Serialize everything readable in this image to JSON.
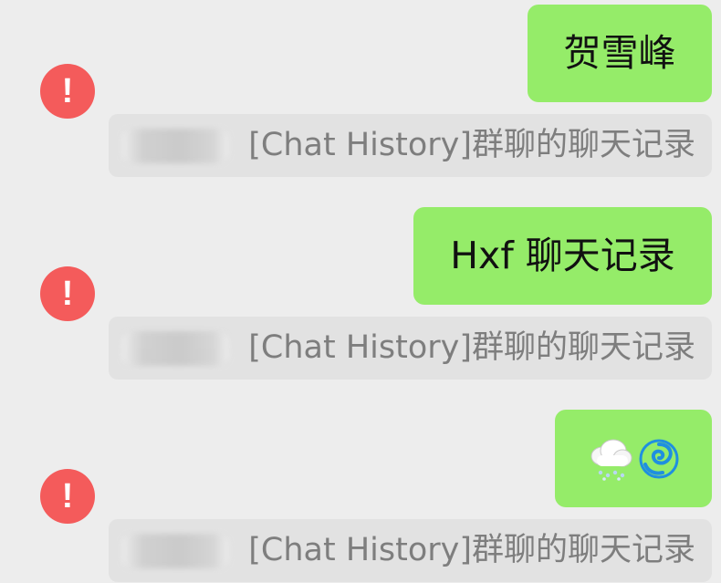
{
  "messages": [
    {
      "text": "贺雪峰",
      "quote": "[Chat History]群聊的聊天记录"
    },
    {
      "text": "Hxf 聊天记录",
      "quote": "[Chat History]群聊的聊天记录"
    },
    {
      "text": "",
      "icons": [
        "cloud-with-snow-icon",
        "cyclone-icon"
      ],
      "quote": "[Chat History]群聊的聊天记录"
    }
  ],
  "colors": {
    "background": "#ededed",
    "bubble": "#95ec69",
    "error": "#f45b5b",
    "quote_background": "#e2e2e2",
    "quote_text": "#7e7e7e"
  }
}
